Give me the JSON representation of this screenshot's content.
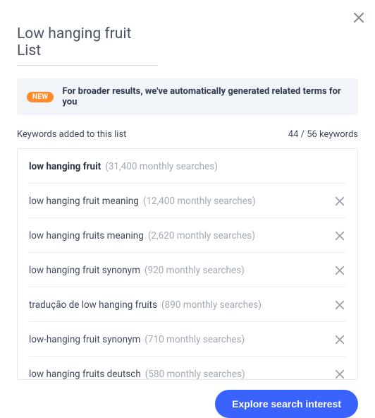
{
  "close_label": "Close",
  "title": "Low hanging fruit List",
  "banner": {
    "badge": "NEW",
    "text": "For broader results, we've automatically generated related terms for you"
  },
  "meta": {
    "label": "Keywords added to this list",
    "count_text": "44 / 56 keywords"
  },
  "items": [
    {
      "keyword": "low hanging fruit",
      "searches": "(31,400 monthly searches)"
    },
    {
      "keyword": "low hanging fruit meaning",
      "searches": "(12,400 monthly searches)"
    },
    {
      "keyword": "low hanging fruits meaning",
      "searches": "(2,620 monthly searches)"
    },
    {
      "keyword": "low hanging fruit synonym",
      "searches": "(920 monthly searches)"
    },
    {
      "keyword": "tradução de low hanging fruits",
      "searches": "(890 monthly searches)"
    },
    {
      "keyword": "low-hanging fruit synonym",
      "searches": "(710 monthly searches)"
    },
    {
      "keyword": "low hanging fruits deutsch",
      "searches": "(580 monthly searches)"
    }
  ],
  "cta": "Explore search interest"
}
